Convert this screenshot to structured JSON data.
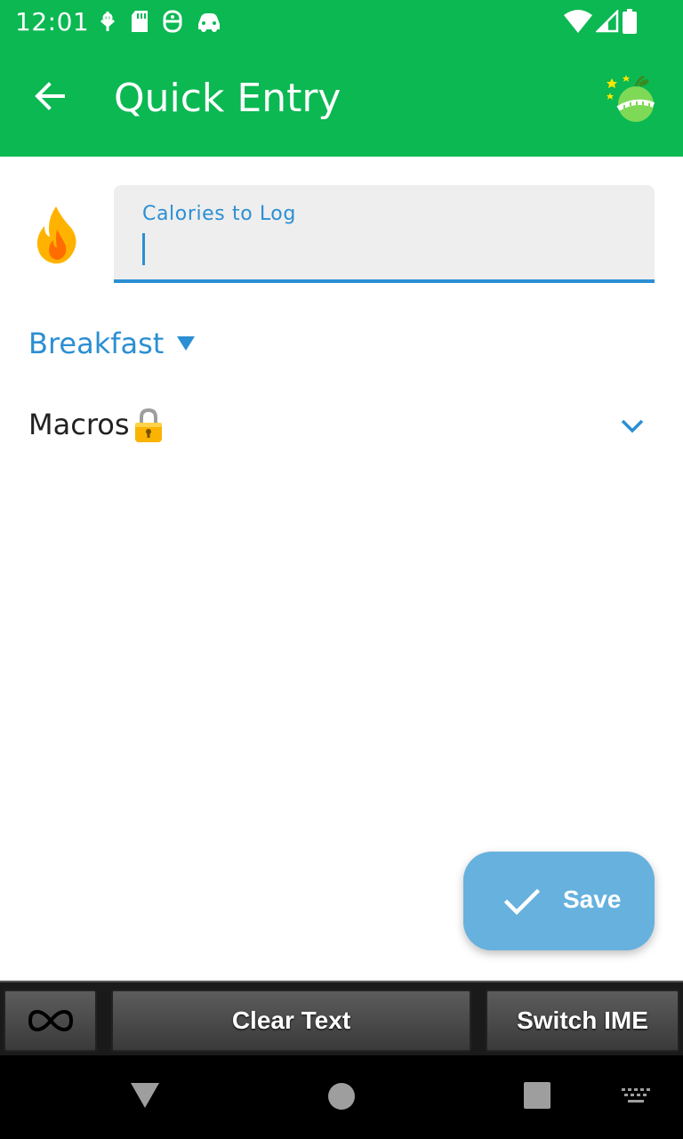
{
  "status_bar": {
    "time": "12:01",
    "icons_left": [
      "usb-debug-icon",
      "sd-card-icon",
      "accessibility-icon",
      "car-icon"
    ],
    "icons_right": [
      "wifi-icon",
      "cell-signal-icon",
      "battery-icon"
    ]
  },
  "app_bar": {
    "title": "Quick Entry",
    "back_icon": "arrow-back-icon",
    "logo_icon": "apple-measure-logo-icon",
    "background": "#0bb852"
  },
  "calories": {
    "label": "Calories to Log",
    "value": "",
    "icon": "flame-icon",
    "accent": "#2b8fd3"
  },
  "meal": {
    "selected": "Breakfast",
    "icon": "dropdown-triangle-icon"
  },
  "macros": {
    "label": "Macros",
    "lock_icon": "lock-icon",
    "expand_icon": "chevron-down-icon"
  },
  "save": {
    "label": "Save",
    "icon": "check-icon",
    "color": "#66b1de"
  },
  "ime_bar": {
    "loop_icon": "infinity-icon",
    "clear_label": "Clear Text",
    "switch_label": "Switch IME"
  },
  "nav_bar": {
    "items": [
      "back-triangle-icon",
      "home-circle-icon",
      "recents-square-icon",
      "keyboard-icon"
    ]
  }
}
